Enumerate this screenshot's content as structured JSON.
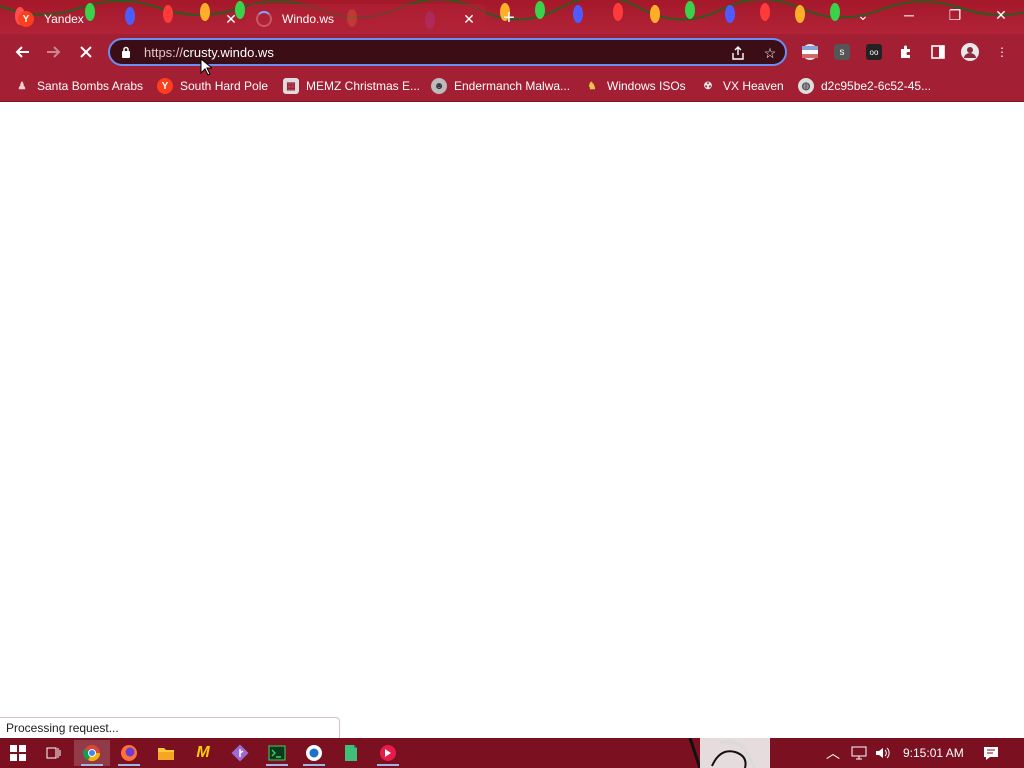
{
  "tabs": [
    {
      "title": "Yandex",
      "favicon": "yandex-icon",
      "state": "inactive"
    },
    {
      "title": "Windo.ws",
      "favicon": "loading-spinner-icon",
      "state": "active"
    }
  ],
  "window_controls": [
    "dropdown-icon",
    "minimize-icon",
    "restore-icon",
    "close-icon"
  ],
  "toolbar": {
    "back": "back-arrow-icon",
    "forward": "forward-arrow-icon",
    "stop": "stop-loading-icon"
  },
  "omnibox": {
    "scheme": "https://",
    "host": "crusty.windo.ws"
  },
  "bookmarks": [
    {
      "label": "Santa Bombs Arabs",
      "icon": "santa-icon"
    },
    {
      "label": "South Hard Pole",
      "icon": "yandex-icon"
    },
    {
      "label": "MEMZ Christmas E...",
      "icon": "memz-icon"
    },
    {
      "label": "Endermanch Malwa...",
      "icon": "endermanch-icon"
    },
    {
      "label": "Windows ISOs",
      "icon": "windows-iso-icon"
    },
    {
      "label": "VX Heaven",
      "icon": "vx-heaven-icon"
    },
    {
      "label": "d2c95be2-6c52-45...",
      "icon": "globe-icon"
    }
  ],
  "status_bar": {
    "text": "Processing request..."
  },
  "taskbar": {
    "clock": "9:15:01 AM",
    "apps": [
      "chrome-icon",
      "firefox-icon",
      "file-explorer-icon",
      "malwarebytes-icon",
      "git-icon",
      "terminal-icon",
      "app-icon",
      "notepad-icon",
      "red-app-icon"
    ]
  },
  "colors": {
    "chrome_frame": "#a31f33",
    "omnibox_bg": "#3b0d15",
    "omnibox_focus": "#6a8ef5",
    "taskbar": "#7a1020"
  }
}
